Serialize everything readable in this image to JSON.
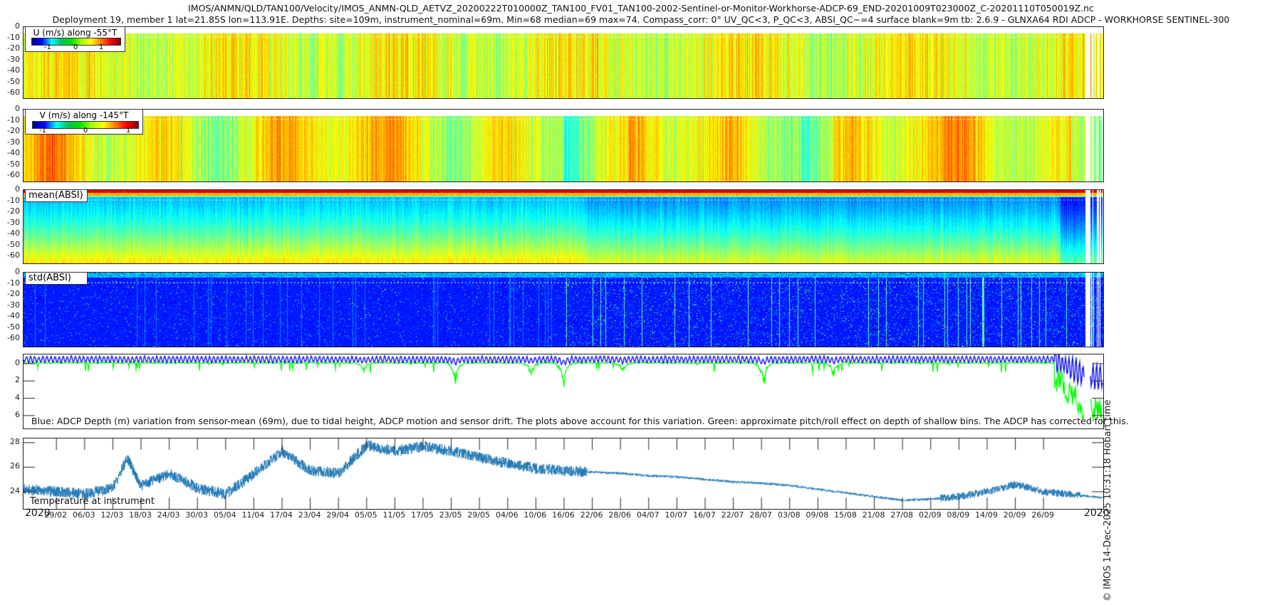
{
  "title_line1": "IMOS/ANMN/QLD/TAN100/Velocity/IMOS_ANMN-QLD_AETVZ_20200222T010000Z_TAN100_FV01_TAN100-2002-Sentinel-or-Monitor-Workhorse-ADCP-69_END-20201009T023000Z_C-20201110T050019Z.nc",
  "title_line2": "Deployment 19, member 1 lat=21.85S lon=113.91E. Depths: site=109m, instrument_nominal=69m. Min=68 median=69 max=74. Compass_corr: 0° UV_QC<3, P_QC<3, ABSI_QC~=4 surface blank=9m tb: 2.6.9 - GLNXA64 RDI ADCP - WORKHORSE SENTINEL-300",
  "timestamp": "© IMOS 14-Dec-2025 10:31:18 Hobart time",
  "chart_data": [
    {
      "type": "heatmap",
      "legend": "U (m/s) along -55°T",
      "colorbar_ticks": [
        "-1",
        "0",
        "1"
      ],
      "clim": [
        -1.3,
        1.3
      ],
      "colormap": "jet",
      "yticks": [
        "0",
        "-10",
        "-20",
        "-30",
        "-40",
        "-50",
        "-60"
      ],
      "ylim": [
        -66,
        0
      ]
    },
    {
      "type": "heatmap",
      "legend": "V (m/s) along -145°T",
      "colorbar_ticks": [
        "-1",
        "0",
        "1"
      ],
      "clim": [
        -1.3,
        1.3
      ],
      "colormap": "jet",
      "yticks": [
        "0",
        "-10",
        "-20",
        "-30",
        "-40",
        "-50",
        "-60"
      ],
      "ylim": [
        -66,
        0
      ]
    },
    {
      "type": "heatmap",
      "legend": "mean(ABSI)",
      "colormap": "jet",
      "yticks": [
        "0",
        "-10",
        "-20",
        "-30",
        "-40",
        "-50",
        "-60"
      ],
      "ylim": [
        -66,
        0
      ]
    },
    {
      "type": "heatmap",
      "legend": "std(ABSI)",
      "colormap": "jet",
      "yticks": [
        "0",
        "-10",
        "-20",
        "-30",
        "-40",
        "-50",
        "-60"
      ],
      "ylim": [
        -66,
        0
      ]
    },
    {
      "type": "line",
      "yticks": [
        "0",
        "2",
        "4",
        "6"
      ],
      "ylim": [
        -1.07,
        7.5
      ],
      "reversed": true,
      "note": "Blue: ADCP Depth (m) variation from sensor-mean (69m), due to tidal height, ADCP motion and sensor drift. The plots above account for this variation. Green: approximate pitch/roll effect on depth of shallow bins. The ADCP has corrected for this.",
      "series": [
        {
          "color": "#0000ff"
        },
        {
          "color": "#00ff00"
        }
      ]
    },
    {
      "type": "line",
      "label": "Temperature at instrument",
      "yticks": [
        "28",
        "26",
        "24"
      ],
      "ylim": [
        22.6,
        28.34
      ],
      "color": "#1f77b4",
      "x": [
        "22/02",
        "29/02",
        "06/03",
        "12/03",
        "15/03",
        "18/03",
        "24/03",
        "30/03",
        "05/04",
        "11/04",
        "17/04",
        "23/04",
        "29/04",
        "05/05",
        "11/05",
        "17/05",
        "23/05",
        "29/05",
        "04/06",
        "10/06",
        "16/06",
        "22/06",
        "28/06",
        "04/07",
        "10/07",
        "16/07",
        "22/07",
        "28/07",
        "03/08",
        "09/08",
        "15/08",
        "21/08",
        "27/08",
        "02/09",
        "08/09",
        "14/09",
        "20/09",
        "26/09",
        "09/10"
      ],
      "y": [
        24.2,
        24.0,
        23.8,
        24.3,
        26.7,
        24.5,
        25.5,
        24.3,
        23.8,
        25.5,
        27.3,
        25.7,
        25.5,
        27.8,
        27.3,
        27.7,
        27.3,
        26.8,
        26.3,
        25.9,
        25.7,
        25.6,
        25.5,
        25.3,
        25.2,
        25.0,
        24.8,
        24.7,
        24.5,
        24.2,
        23.9,
        23.6,
        23.3,
        23.4,
        23.6,
        24.0,
        24.6,
        24.0,
        23.5
      ]
    }
  ],
  "xaxis": {
    "year_left": "2020",
    "year_right": "2020",
    "ticks": [
      "29/02",
      "06/03",
      "12/03",
      "18/03",
      "24/03",
      "30/03",
      "05/04",
      "11/04",
      "17/04",
      "23/04",
      "29/04",
      "05/05",
      "11/05",
      "17/05",
      "23/05",
      "29/05",
      "04/06",
      "10/06",
      "16/06",
      "22/06",
      "28/06",
      "04/07",
      "10/07",
      "16/07",
      "22/07",
      "28/07",
      "03/08",
      "09/08",
      "15/08",
      "21/08",
      "27/08",
      "02/09",
      "08/09",
      "14/09",
      "20/09",
      "26/09"
    ]
  }
}
